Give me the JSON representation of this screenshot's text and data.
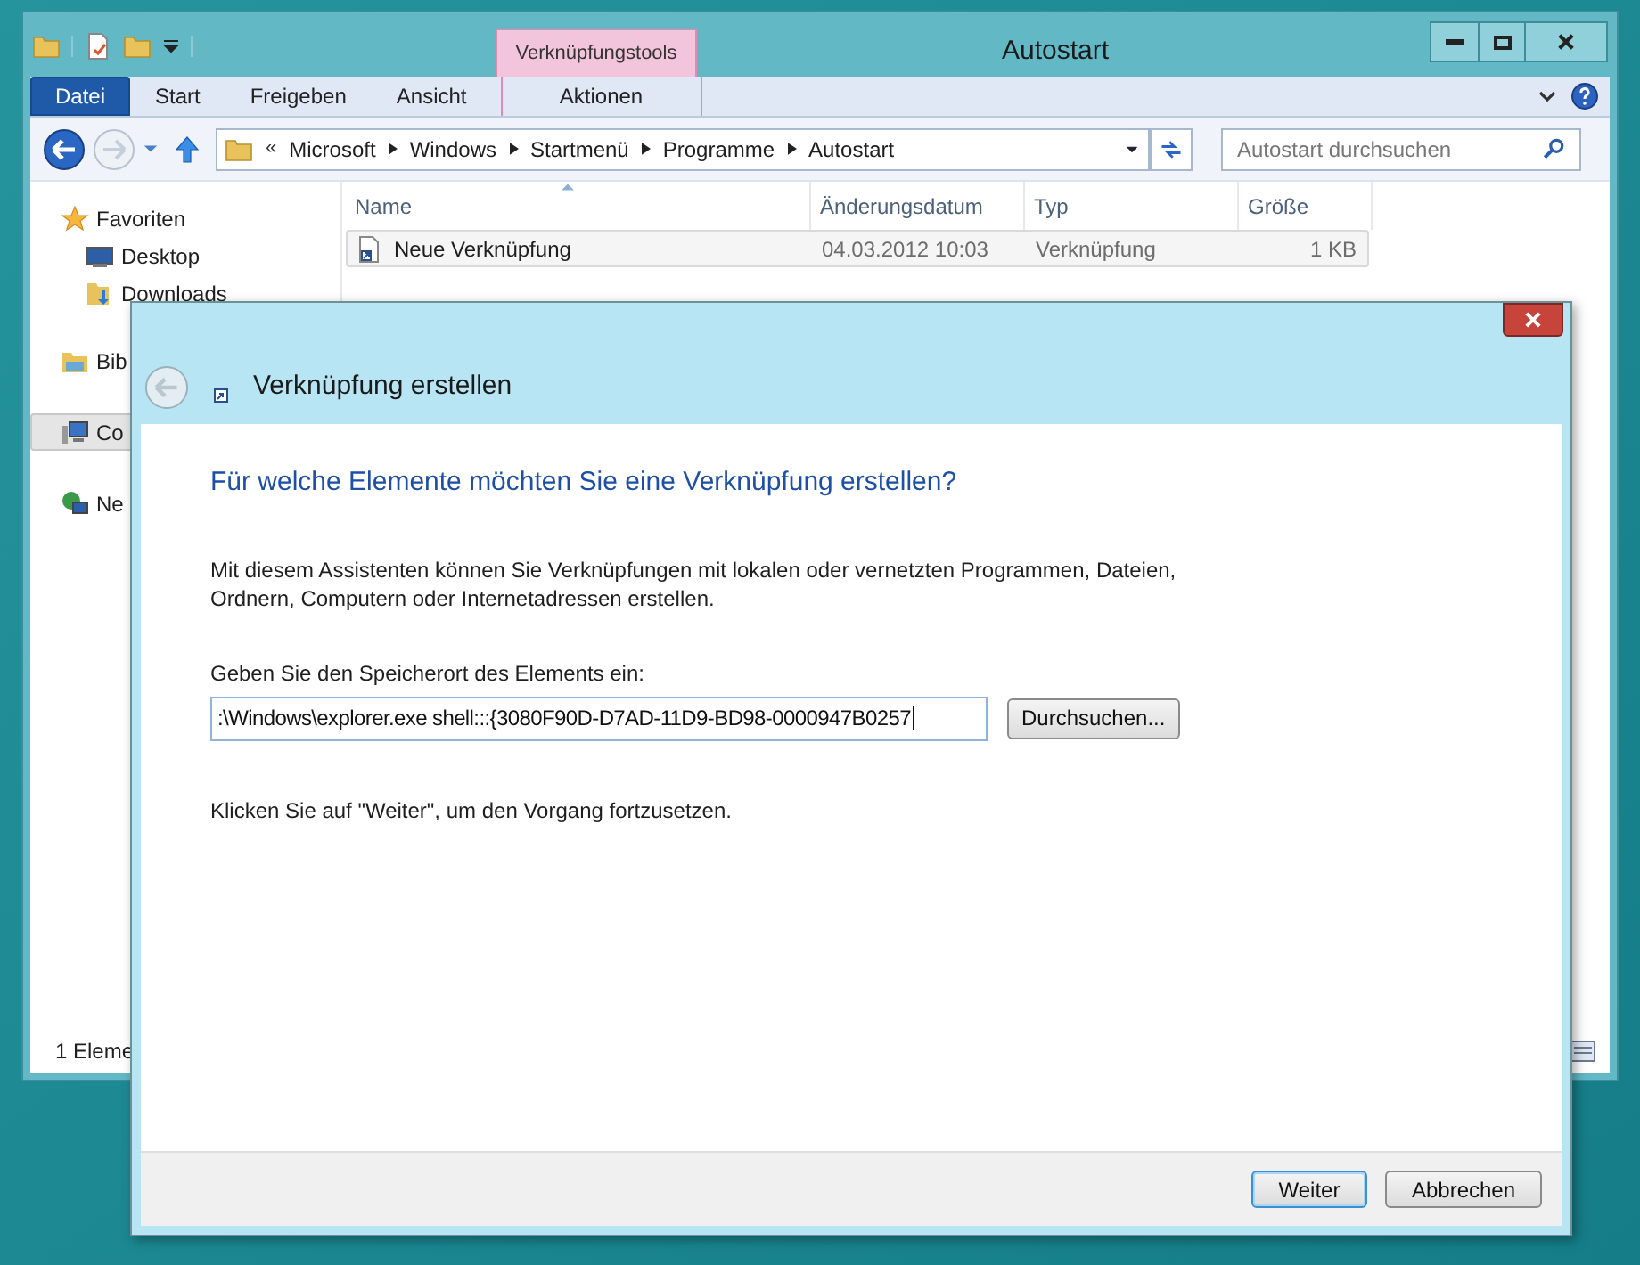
{
  "explorer": {
    "title": "Autostart",
    "contextual_group": "Verknüpfungstools",
    "ribbon_tabs": [
      {
        "label": "Datei",
        "kind": "file"
      },
      {
        "label": "Start",
        "kind": "tab"
      },
      {
        "label": "Freigeben",
        "kind": "tab"
      },
      {
        "label": "Ansicht",
        "kind": "tab"
      },
      {
        "label": "Aktionen",
        "kind": "contextual"
      }
    ],
    "breadcrumb": {
      "overflow": "«",
      "items": [
        "Microsoft",
        "Windows",
        "Startmenü",
        "Programme",
        "Autostart"
      ]
    },
    "search": {
      "placeholder": "Autostart durchsuchen"
    },
    "navigation": [
      {
        "label": "Favoriten",
        "kind": "star",
        "selected": false,
        "children": [
          {
            "label": "Desktop",
            "kind": "desktop",
            "selected": false
          },
          {
            "label": "Downloads",
            "kind": "downloads",
            "selected": false
          }
        ]
      },
      {
        "label": "Bib",
        "kind": "libraries",
        "selected": false
      },
      {
        "label": "Co",
        "kind": "computer",
        "selected": true
      },
      {
        "label": "Ne",
        "kind": "network",
        "selected": false
      }
    ],
    "columns": [
      "Name",
      "Änderungsdatum",
      "Typ",
      "Größe"
    ],
    "rows": [
      {
        "name": "Neue Verknüpfung",
        "date": "04.03.2012 10:03",
        "type": "Verknüpfung",
        "size": "1 KB",
        "highlighted": true
      }
    ],
    "status_bar": "1 Eleme"
  },
  "dialog": {
    "title": "Verknüpfung erstellen",
    "heading": "Für welche Elemente möchten Sie eine Verknüpfung erstellen?",
    "description": "Mit diesem Assistenten können Sie Verknüpfungen mit lokalen oder vernetzten Programmen, Dateien, Ordnern, Computern oder Internetadressen erstellen.",
    "location_label": "Geben Sie den Speicherort des Elements ein:",
    "location_value": ":\\Windows\\explorer.exe shell:::{3080F90D-D7AD-11D9-BD98-0000947B0257",
    "browse_button": "Durchsuchen...",
    "hint": "Klicken Sie auf \"Weiter\", um den Vorgang fortzusetzen.",
    "buttons": [
      {
        "label": "Weiter",
        "default": true
      },
      {
        "label": "Abbrechen",
        "default": false
      }
    ]
  }
}
